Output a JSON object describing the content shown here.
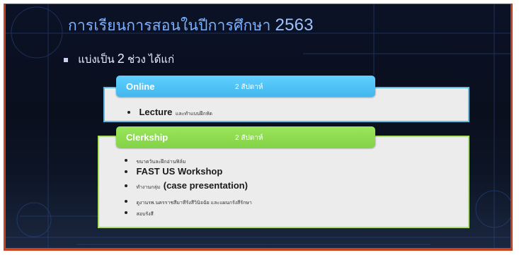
{
  "slide": {
    "title_text": "การเรียนการสอนในปีการศึกษา",
    "title_year": "2563",
    "bullet_prefix": "แบ่งเป็น",
    "bullet_number": "2",
    "bullet_suffix": "ช่วง ได้แก่"
  },
  "online": {
    "label": "Online",
    "duration": "2 สัปดาห์",
    "items": [
      {
        "main": "Lecture",
        "note": "และทำแบบฝึกหัด"
      }
    ]
  },
  "clerkship": {
    "label": "Clerkship",
    "duration": "2 สัปดาห์",
    "items": [
      {
        "text": "ขนาดวันละฝึกอ่านฟิล์ม"
      },
      {
        "text": "FAST US Workshop"
      },
      {
        "prefix": "ทำงานกลุ่ม",
        "text": "(case presentation)"
      },
      {
        "text": "ดูงานรพ.นครราชสีมาทีรังสีวินิจฉัย และแผนกรังสีรักษา"
      },
      {
        "text": "สอบรังสี"
      }
    ]
  },
  "colors": {
    "title": "#7fb0ff",
    "online_accent": "#4fc3f5",
    "clerkship_accent": "#8ed94f",
    "frame_border": "#c8431d"
  }
}
